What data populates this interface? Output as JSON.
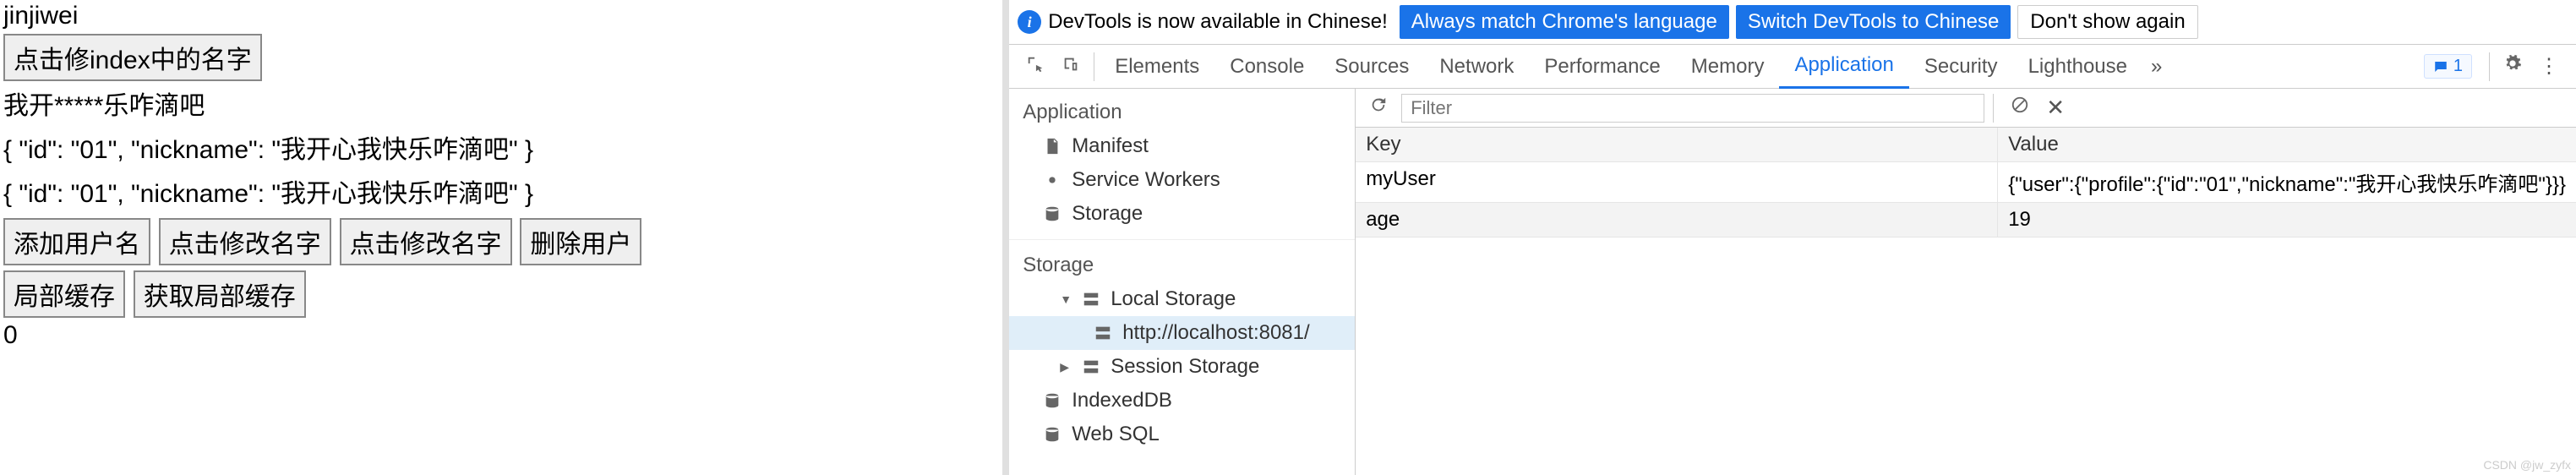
{
  "left": {
    "username": "jinjiwei",
    "btn_modify_index": "点击修index中的名字",
    "masked_line": "我开*****乐咋滴吧",
    "obj1": "{ \"id\": \"01\", \"nickname\": \"我开心我快乐咋滴吧\" }",
    "obj2": "{ \"id\": \"01\", \"nickname\": \"我开心我快乐咋滴吧\" }",
    "btn_add_user": "添加用户名",
    "btn_modify_name1": "点击修改名字",
    "btn_modify_name2": "点击修改名字",
    "btn_delete_user": "删除用户",
    "btn_local_cache": "局部缓存",
    "btn_get_local_cache": "获取局部缓存",
    "zero": "0"
  },
  "banner": {
    "msg": "DevTools is now available in Chinese!",
    "btn1": "Always match Chrome's language",
    "btn2": "Switch DevTools to Chinese",
    "btn3": "Don't show again"
  },
  "tabs": {
    "elements": "Elements",
    "console": "Console",
    "sources": "Sources",
    "network": "Network",
    "performance": "Performance",
    "memory": "Memory",
    "application": "Application",
    "security": "Security",
    "lighthouse": "Lighthouse",
    "msg_count": "1"
  },
  "sidebar": {
    "application_label": "Application",
    "manifest": "Manifest",
    "service_workers": "Service Workers",
    "storage1": "Storage",
    "storage_label": "Storage",
    "local_storage": "Local Storage",
    "local_storage_url": "http://localhost:8081/",
    "session_storage": "Session Storage",
    "indexed_db": "IndexedDB",
    "web_sql": "Web SQL"
  },
  "filter": {
    "placeholder": "Filter"
  },
  "grid": {
    "header_key": "Key",
    "header_value": "Value",
    "rows": [
      {
        "key": "myUser",
        "value": "{\"user\":{\"profile\":{\"id\":\"01\",\"nickname\":\"我开心我快乐咋滴吧\"}}}"
      },
      {
        "key": "age",
        "value": "19"
      }
    ]
  },
  "watermark": "CSDN @jw_zyfx"
}
